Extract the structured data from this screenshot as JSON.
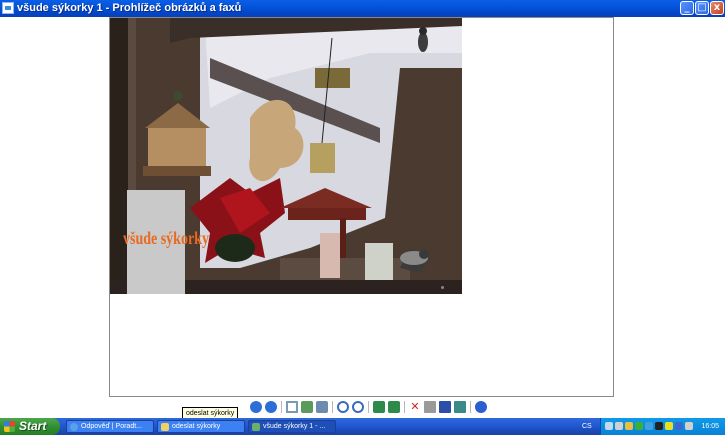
{
  "window": {
    "title": "všude sýkorky 1 - Prohlížeč obrázků a faxů",
    "controls": {
      "minimize": "_",
      "maximize": "□",
      "close": "x"
    }
  },
  "picture": {
    "overlay_text": "všude sýkorky",
    "subject": "photo of birds at feeders with poinsettia"
  },
  "toolbar": {
    "buttons": [
      "previous-image-icon",
      "next-image-icon",
      "best-fit-icon",
      "actual-size-icon",
      "slideshow-icon",
      "zoom-in-icon",
      "zoom-out-icon",
      "rotate-clockwise-icon",
      "rotate-counterclockwise-icon",
      "delete-icon",
      "print-icon",
      "save-icon",
      "open-with-icon",
      "help-icon"
    ],
    "tooltip": "odeslat sýkorky"
  },
  "taskbar": {
    "start_label": "Start",
    "tasks": [
      {
        "label": "Odpověď | Poradt...",
        "icon": "ie-icon"
      },
      {
        "label": "odeslat sýkorky",
        "icon": "folder-icon"
      },
      {
        "label": "všude sýkorky 1 - ...",
        "icon": "image-viewer-icon"
      }
    ],
    "language": "CS",
    "clock": "16:05"
  },
  "colors": {
    "titlebar": "#0553d8",
    "taskbar": "#245edb",
    "start": "#2f8a2f",
    "overlay_text": "#e86a20"
  }
}
